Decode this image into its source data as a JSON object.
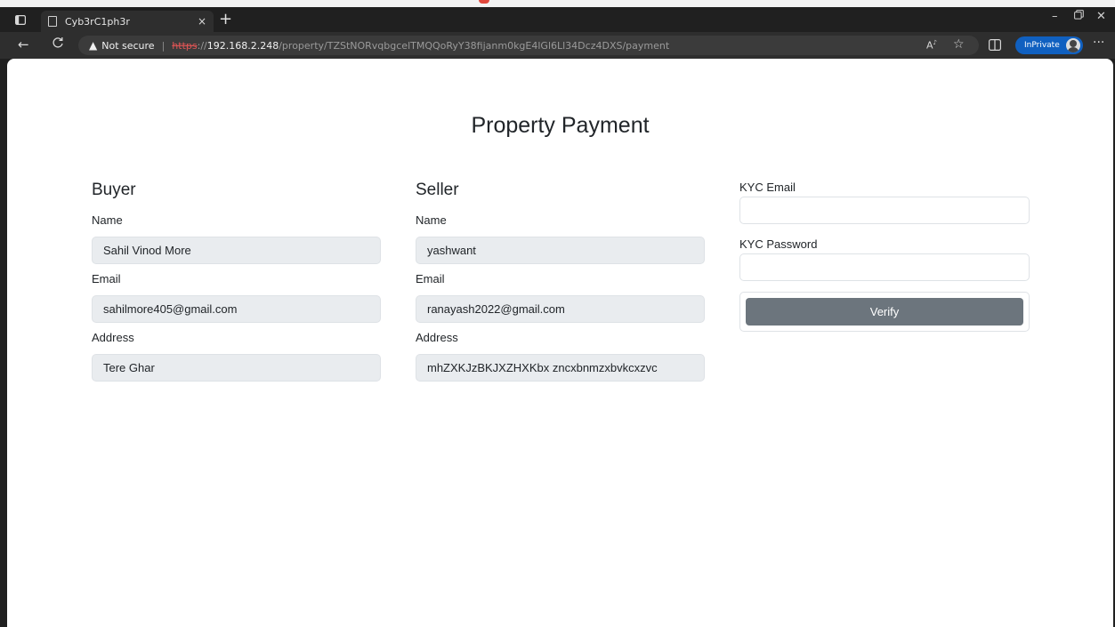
{
  "browser": {
    "tab_title": "Cyb3rC1ph3r",
    "tab_close": "×",
    "new_tab": "+",
    "url": {
      "warning_label": "Not secure",
      "separator": "|",
      "scheme": "https",
      "scheme_sep": "://",
      "host": "192.168.2.248",
      "path": "/property/TZStNORvqbgcelTMQQoRyY38fijanm0kgE4lGl6Ll34Dcz4DXS/payment"
    },
    "inprivate_label": "InPrivate",
    "icons": [
      "tab-actions-icon",
      "back-icon",
      "refresh-icon",
      "read-aloud-icon",
      "favorite-icon",
      "split-screen-icon",
      "more-icon",
      "minimize-icon",
      "maximize-icon",
      "close-icon"
    ]
  },
  "page": {
    "title": "Property Payment",
    "buyer": {
      "heading": "Buyer",
      "name_label": "Name",
      "name": "Sahil Vinod More",
      "email_label": "Email",
      "email": "sahilmore405@gmail.com",
      "address_label": "Address",
      "address": "Tere Ghar"
    },
    "seller": {
      "heading": "Seller",
      "name_label": "Name",
      "name": "yashwant",
      "email_label": "Email",
      "email": "ranayash2022@gmail.com",
      "address_label": "Address",
      "address": "mhZXKJzBKJXZHXKbx zncxbnmzxbvkcxzvc"
    },
    "kyc": {
      "email_label": "KYC Email",
      "email_value": "",
      "password_label": "KYC Password",
      "password_value": "",
      "verify_label": "Verify"
    }
  },
  "colors": {
    "verify_button": "#6c757d",
    "readonly_field": "#e9ecef",
    "inprivate_badge": "#1060c0"
  }
}
